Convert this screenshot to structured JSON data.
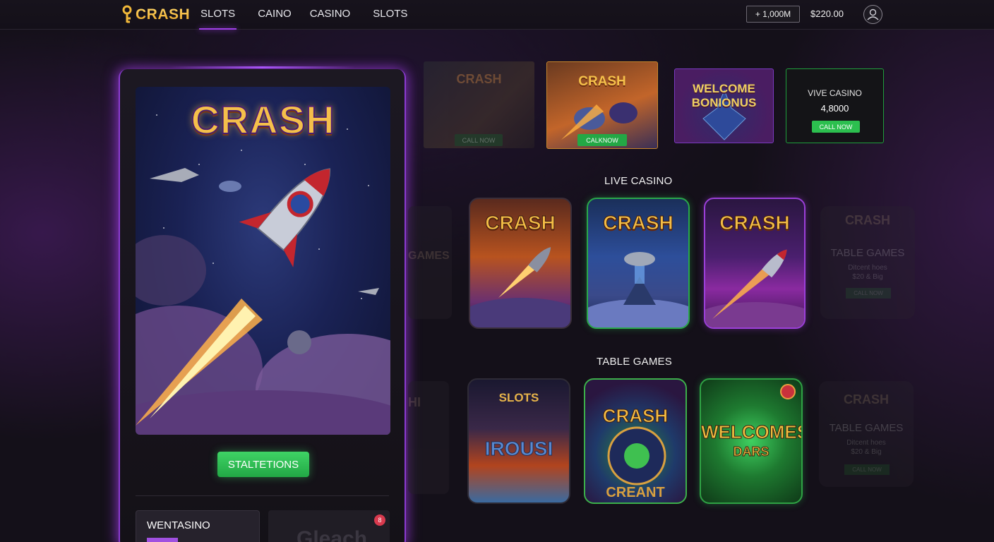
{
  "header": {
    "logo": "CRASH",
    "nav": [
      "SLOTS",
      "CAINO",
      "CASINO",
      "SLOTS"
    ],
    "deposit_label": "+ 1,000M",
    "balance": "$220.00"
  },
  "featured": {
    "title": "CRASH",
    "play_label": "STALTETIONS",
    "mini_card_label": "WENTASINO",
    "mini_card_ghost": "Gleach",
    "mini_card_badge": "8"
  },
  "promos": [
    {
      "title": "CRASH",
      "button": "CALL NOW"
    },
    {
      "title": "CRASH",
      "button": "CALKNOW"
    },
    {
      "title_line1": "WELCOME",
      "title_line2": "BONIONUS"
    },
    {
      "title": "VIVE CASINO",
      "amount": "4,8000",
      "button": "CALL NOW"
    }
  ],
  "sections": {
    "live_casino": "LIVE CASINO",
    "table_games": "TABLE GAMES"
  },
  "live_cards": [
    {
      "title": "CRASH"
    },
    {
      "title": "CRASH"
    },
    {
      "title": "CRASH"
    }
  ],
  "live_ghost": {
    "title": "CRASH",
    "subtitle": "TABLE GAMES",
    "line": "Ditcent hoes",
    "line2": "$20 & Big",
    "button": "CALL NOW"
  },
  "table_cards": [
    {
      "title": "SLOTS",
      "sub": "IROUSI"
    },
    {
      "title": "CRASH",
      "sub": "CREANT"
    },
    {
      "title_line1": "WELCOMES",
      "title_line2": "DARS"
    }
  ],
  "table_ghost": {
    "title": "CRASH",
    "subtitle": "TABLE GAMES",
    "line": "Ditcent hoes",
    "line2": "$20 & Big",
    "button": "CALL NOW"
  },
  "edge_texts": {
    "live": "GAMES",
    "table": "HI"
  },
  "colors": {
    "accent": "#a040e8",
    "cta": "#2cbf4f",
    "gold": "#f4bd45",
    "background": "#141019"
  }
}
